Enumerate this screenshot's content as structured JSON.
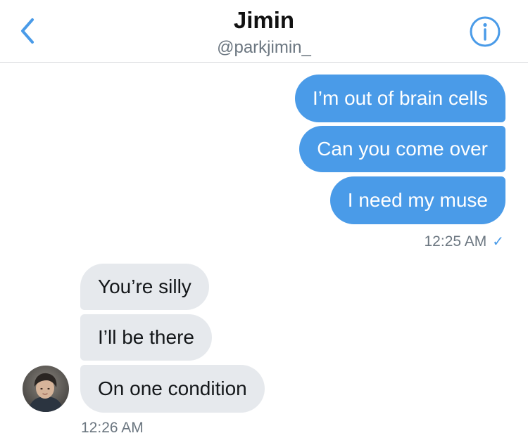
{
  "header": {
    "title": "Jimin",
    "handle": "@parkjimin_",
    "back_icon": "chevron-left-icon",
    "info_icon": "info-circle-icon",
    "accent_color": "#4a9be8"
  },
  "messages": {
    "outgoing": [
      "I’m out of brain cells",
      "Can you come over",
      "I need my muse"
    ],
    "outgoing_time": "12:25 AM",
    "outgoing_status_icon": "checkmark-icon",
    "outgoing_status_glyph": "✓",
    "incoming": [
      "You’re silly",
      "I’ll be there",
      "On one condition"
    ],
    "incoming_time": "12:26 AM"
  },
  "colors": {
    "outgoing_bubble": "#4a9be8",
    "incoming_bubble": "#e6e9ed",
    "secondary_text": "#6b7680"
  }
}
